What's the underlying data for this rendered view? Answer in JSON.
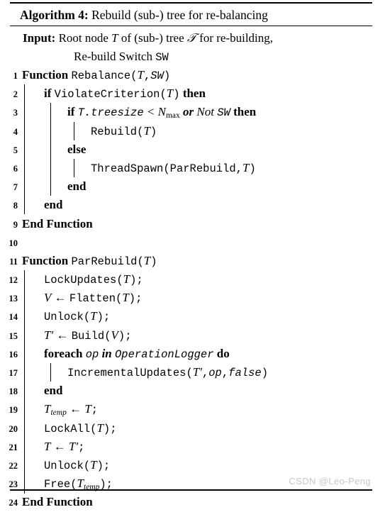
{
  "caption": {
    "label": "Algorithm 4:",
    "title": "Rebuild (sub-) tree for re-balancing"
  },
  "input": {
    "keyword": "Input:",
    "line1_a": "Root node ",
    "line1_T": "T",
    "line1_b": " of (sub-) tree ",
    "line1_cal": "𝒯",
    "line1_c": " for re-building,",
    "line2_a": "Re-build Switch ",
    "line2_mono": "SW"
  },
  "lines": [
    {
      "no": "1",
      "text": "Function Rebalance(T,SW)"
    },
    {
      "no": "2",
      "text": "if ViolateCriterion(T) then"
    },
    {
      "no": "3",
      "text": "if T.treesize < Nmax or Not SW then"
    },
    {
      "no": "4",
      "text": "Rebuild(T)"
    },
    {
      "no": "5",
      "text": "else"
    },
    {
      "no": "6",
      "text": "ThreadSpawn(ParRebuild,T)"
    },
    {
      "no": "7",
      "text": "end"
    },
    {
      "no": "8",
      "text": "end"
    },
    {
      "no": "9",
      "text": "End Function"
    },
    {
      "no": "10",
      "text": ""
    },
    {
      "no": "11",
      "text": "Function ParRebuild(T)"
    },
    {
      "no": "12",
      "text": "LockUpdates(T);"
    },
    {
      "no": "13",
      "text": "V ← Flatten(T);"
    },
    {
      "no": "14",
      "text": "Unlock(T);"
    },
    {
      "no": "15",
      "text": "T′ ← Build(V);"
    },
    {
      "no": "16",
      "text": "foreach op in OperationLogger do"
    },
    {
      "no": "17",
      "text": "IncrementalUpdates(T′,op,false)"
    },
    {
      "no": "18",
      "text": "end"
    },
    {
      "no": "19",
      "text": "Ttemp ← T;"
    },
    {
      "no": "20",
      "text": "LockAll(T);"
    },
    {
      "no": "21",
      "text": "T ← T′;"
    },
    {
      "no": "22",
      "text": "Unlock(T);"
    },
    {
      "no": "23",
      "text": "Free(Ttemp);"
    },
    {
      "no": "24",
      "text": "End Function"
    }
  ],
  "tokens": {
    "function": "Function",
    "end_function": "End Function",
    "if": "if",
    "then": "then",
    "else": "else",
    "end": "end",
    "foreach": "foreach",
    "in": "in",
    "do": "do",
    "or": "or",
    "not": "Not",
    "rebalance": "Rebalance",
    "violate_criterion": "ViolateCriterion",
    "rebuild": "Rebuild",
    "thread_spawn": "ThreadSpawn",
    "par_rebuild": "ParRebuild",
    "lock_updates": "LockUpdates",
    "flatten": "Flatten",
    "unlock": "Unlock",
    "build": "Build",
    "incremental_updates": "IncrementalUpdates",
    "lock_all": "LockAll",
    "free": "Free",
    "operation_logger": "OperationLogger",
    "op": "op",
    "false": "false",
    "sw": "SW",
    "T": "T",
    "V": "V",
    "N": "N",
    "max": "max",
    "temp": "temp",
    "treesize": "T.treesize",
    "lt": "<",
    "arrow": "←",
    "semi": ";",
    "comma": ",",
    "lparen": "(",
    "rparen": ")",
    "prime": "′"
  },
  "watermark": "CSDN @Leo-Peng"
}
